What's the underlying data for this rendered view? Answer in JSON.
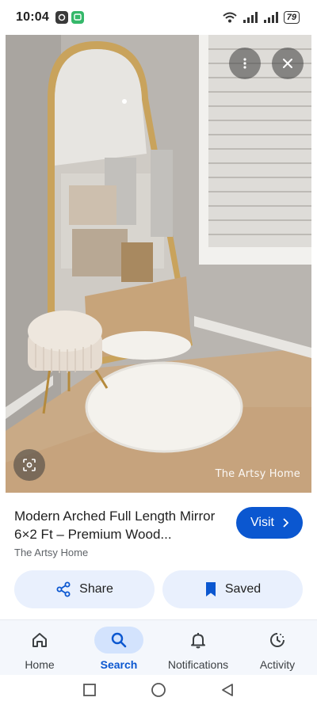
{
  "status_bar": {
    "time": "10:04",
    "notif_a": "",
    "notif_b": "",
    "battery": "79"
  },
  "image": {
    "watermark": "The Artsy Home",
    "more_icon": "more-vert-icon",
    "close_icon": "close-icon",
    "lens_icon": "lens-icon"
  },
  "info": {
    "title": "Modern Arched Full Length Mirror 6×2 Ft – Premium Wood...",
    "source": "The Artsy Home",
    "visit_label": "Visit"
  },
  "actions": {
    "share_label": "Share",
    "saved_label": "Saved"
  },
  "bottom_nav": {
    "items": [
      {
        "label": "Home",
        "icon": "home-icon"
      },
      {
        "label": "Search",
        "icon": "search-icon",
        "active": true
      },
      {
        "label": "Notifications",
        "icon": "bell-icon"
      },
      {
        "label": "Activity",
        "icon": "activity-icon"
      }
    ]
  },
  "colors": {
    "accent": "#0b57d0",
    "action_bg": "#e9f0fd",
    "nav_active_bg": "#d3e3fd"
  }
}
